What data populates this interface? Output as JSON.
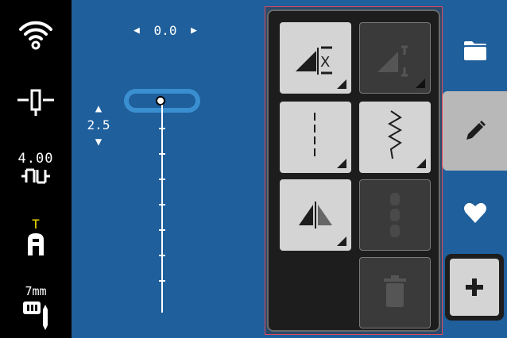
{
  "left_bar": {
    "needle_width": "4.00",
    "foot_letter": "T",
    "stitch_plate": "7mm",
    "icons": [
      "wifi-icon",
      "needle-position-icon",
      "stitch-width-icon",
      "presser-foot-icon",
      "stitch-plate-icon"
    ]
  },
  "main": {
    "needle_offset": "0.0",
    "stitch_length": "2.5"
  },
  "panel": {
    "tiles": [
      {
        "name": "mirror-horizontal",
        "state": "active"
      },
      {
        "name": "mirror-vertical",
        "state": "disabled"
      },
      {
        "name": "straight-stitch",
        "state": "active"
      },
      {
        "name": "zigzag-stitch",
        "state": "active"
      },
      {
        "name": "mirror-flip",
        "state": "active"
      },
      {
        "name": "pattern-sequence",
        "state": "disabled"
      },
      {
        "name": "delete",
        "state": "disabled"
      }
    ]
  },
  "right_bar": {
    "tabs": [
      "folder-icon",
      "edit-icon",
      "favorite-icon",
      "add-icon"
    ],
    "selected": "edit-icon"
  },
  "colors": {
    "background": "#1f5f9c",
    "panel": "#1d1d1d",
    "accent_yellow": "#f5e000",
    "selected_tab": "#b8b8b8"
  }
}
